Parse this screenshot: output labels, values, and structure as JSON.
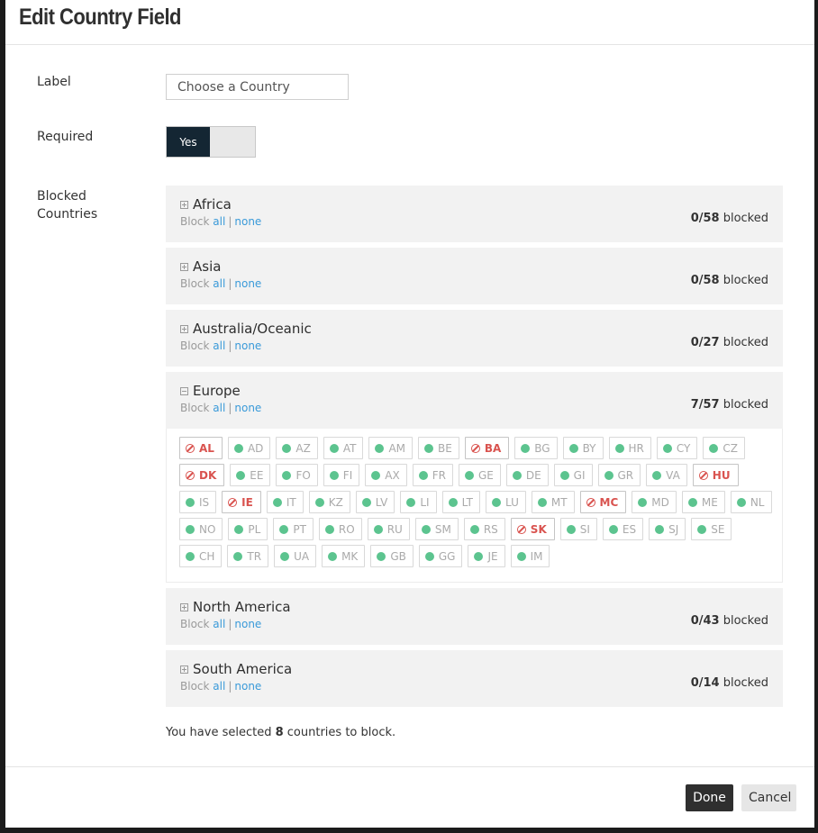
{
  "modal": {
    "title": "Edit Country Field"
  },
  "form": {
    "label_caption": "Label",
    "label_value": "Choose a Country",
    "required_caption": "Required",
    "required_toggle_label": "Yes",
    "required_on": true,
    "blocked_caption": "Blocked Countries"
  },
  "regions": [
    {
      "name": "Africa",
      "block_prefix": "Block",
      "all": "all",
      "sep": "|",
      "none": "none",
      "blocked": "0/58",
      "blocked_suffix": "blocked",
      "expanded": false
    },
    {
      "name": "Asia",
      "block_prefix": "Block",
      "all": "all",
      "sep": "|",
      "none": "none",
      "blocked": "0/58",
      "blocked_suffix": "blocked",
      "expanded": false
    },
    {
      "name": "Australia/Oceanic",
      "block_prefix": "Block",
      "all": "all",
      "sep": "|",
      "none": "none",
      "blocked": "0/27",
      "blocked_suffix": "blocked",
      "expanded": false
    },
    {
      "name": "Europe",
      "block_prefix": "Block",
      "all": "all",
      "sep": "|",
      "none": "none",
      "blocked": "7/57",
      "blocked_suffix": "blocked",
      "expanded": true
    },
    {
      "name": "North America",
      "block_prefix": "Block",
      "all": "all",
      "sep": "|",
      "none": "none",
      "blocked": "0/43",
      "blocked_suffix": "blocked",
      "expanded": false
    },
    {
      "name": "South America",
      "block_prefix": "Block",
      "all": "all",
      "sep": "|",
      "none": "none",
      "blocked": "0/14",
      "blocked_suffix": "blocked",
      "expanded": false
    }
  ],
  "europe_countries": [
    {
      "code": "AL",
      "blocked": true
    },
    {
      "code": "AD",
      "blocked": false
    },
    {
      "code": "AZ",
      "blocked": false
    },
    {
      "code": "AT",
      "blocked": false
    },
    {
      "code": "AM",
      "blocked": false
    },
    {
      "code": "BE",
      "blocked": false
    },
    {
      "code": "BA",
      "blocked": true
    },
    {
      "code": "BG",
      "blocked": false
    },
    {
      "code": "BY",
      "blocked": false
    },
    {
      "code": "HR",
      "blocked": false
    },
    {
      "code": "CY",
      "blocked": false
    },
    {
      "code": "CZ",
      "blocked": false
    },
    {
      "code": "DK",
      "blocked": true
    },
    {
      "code": "EE",
      "blocked": false
    },
    {
      "code": "FO",
      "blocked": false
    },
    {
      "code": "FI",
      "blocked": false
    },
    {
      "code": "AX",
      "blocked": false
    },
    {
      "code": "FR",
      "blocked": false
    },
    {
      "code": "GE",
      "blocked": false
    },
    {
      "code": "DE",
      "blocked": false
    },
    {
      "code": "GI",
      "blocked": false
    },
    {
      "code": "GR",
      "blocked": false
    },
    {
      "code": "VA",
      "blocked": false
    },
    {
      "code": "HU",
      "blocked": true
    },
    {
      "code": "IS",
      "blocked": false
    },
    {
      "code": "IE",
      "blocked": true
    },
    {
      "code": "IT",
      "blocked": false
    },
    {
      "code": "KZ",
      "blocked": false
    },
    {
      "code": "LV",
      "blocked": false
    },
    {
      "code": "LI",
      "blocked": false
    },
    {
      "code": "LT",
      "blocked": false
    },
    {
      "code": "LU",
      "blocked": false
    },
    {
      "code": "MT",
      "blocked": false
    },
    {
      "code": "MC",
      "blocked": true
    },
    {
      "code": "MD",
      "blocked": false
    },
    {
      "code": "ME",
      "blocked": false
    },
    {
      "code": "NL",
      "blocked": false
    },
    {
      "code": "NO",
      "blocked": false
    },
    {
      "code": "PL",
      "blocked": false
    },
    {
      "code": "PT",
      "blocked": false
    },
    {
      "code": "RO",
      "blocked": false
    },
    {
      "code": "RU",
      "blocked": false
    },
    {
      "code": "SM",
      "blocked": false
    },
    {
      "code": "RS",
      "blocked": false
    },
    {
      "code": "SK",
      "blocked": true
    },
    {
      "code": "SI",
      "blocked": false
    },
    {
      "code": "ES",
      "blocked": false
    },
    {
      "code": "SJ",
      "blocked": false
    },
    {
      "code": "SE",
      "blocked": false
    },
    {
      "code": "CH",
      "blocked": false
    },
    {
      "code": "TR",
      "blocked": false
    },
    {
      "code": "UA",
      "blocked": false
    },
    {
      "code": "MK",
      "blocked": false
    },
    {
      "code": "GB",
      "blocked": false
    },
    {
      "code": "GG",
      "blocked": false
    },
    {
      "code": "JE",
      "blocked": false
    },
    {
      "code": "IM",
      "blocked": false
    }
  ],
  "summary": {
    "prefix": "You have selected",
    "count": "8",
    "suffix": "countries to block."
  },
  "footer": {
    "done_label": "Done",
    "cancel_label": "Cancel"
  },
  "colors": {
    "toggle_on": "#142633",
    "allowed_dot": "#5cc48f",
    "blocked_text": "#d9534f",
    "link": "#3a9ad9",
    "done_button": "#2f2f2f"
  }
}
